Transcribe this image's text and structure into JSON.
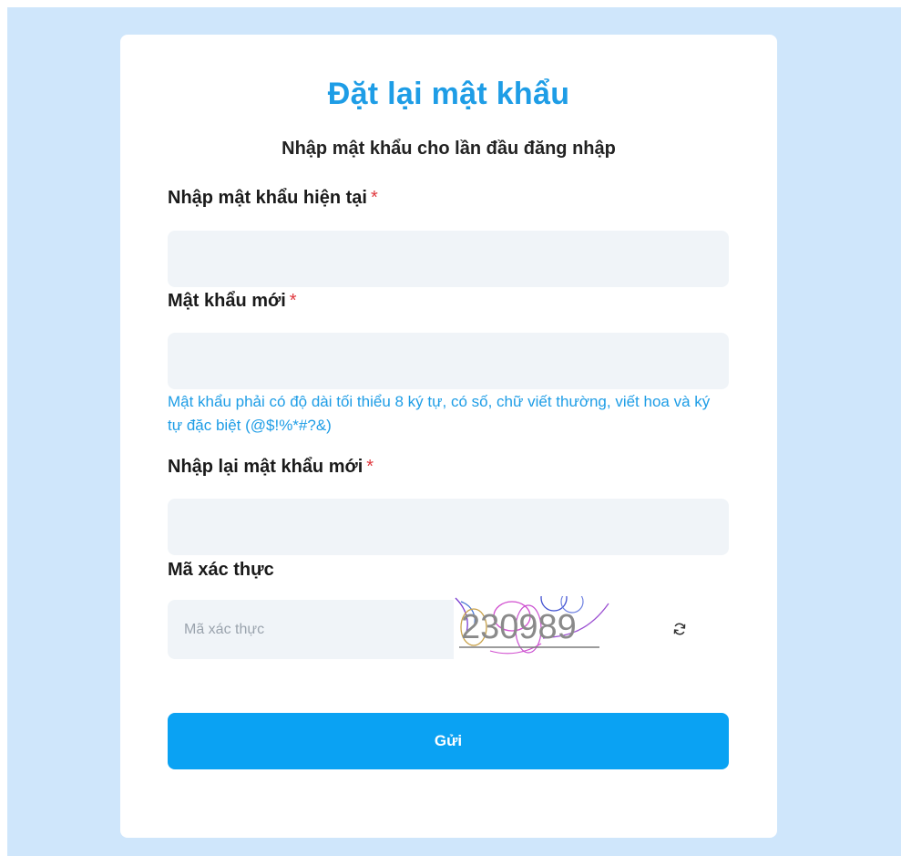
{
  "form": {
    "title": "Đặt lại mật khẩu",
    "subtitle": "Nhập mật khẩu cho lần đầu đăng nhập",
    "current_password": {
      "label": "Nhập mật khẩu hiện tại",
      "required_mark": "*",
      "value": "",
      "placeholder": ""
    },
    "new_password": {
      "label": "Mật khẩu mới",
      "required_mark": "*",
      "value": "",
      "placeholder": ""
    },
    "password_hint": "Mật khẩu phải có độ dài tối thiểu 8 ký tự, có số, chữ viết thường, viết hoa và ký tự đặc biệt (@$!%*#?&)",
    "confirm_password": {
      "label": "Nhập lại mật khẩu mới",
      "required_mark": "*",
      "value": "",
      "placeholder": ""
    },
    "captcha": {
      "label": "Mã xác thực",
      "placeholder": "Mã xác thực",
      "value": "",
      "code": "230989",
      "refresh_icon": "refresh-icon"
    },
    "submit_label": "Gửi"
  },
  "colors": {
    "page_background": "#cfe6fb",
    "accent": "#1e9de6",
    "button": "#0aa2f3",
    "required": "#e0383e",
    "field_background": "#f0f4f8"
  }
}
